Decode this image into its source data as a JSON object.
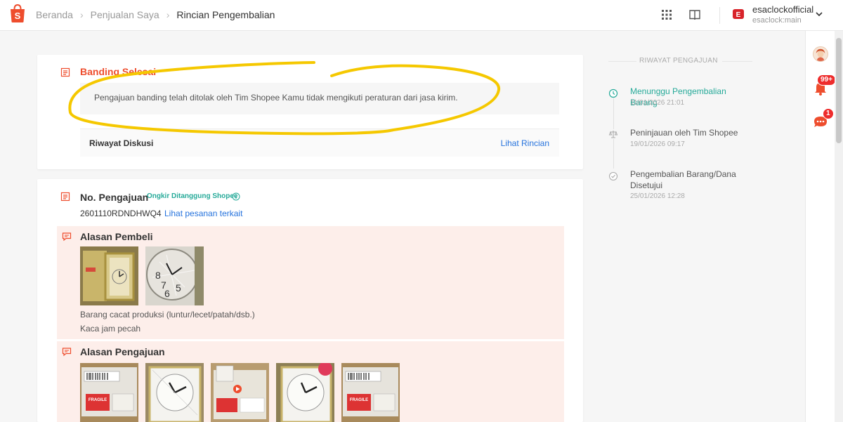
{
  "breadcrumb": {
    "items": [
      "Beranda",
      "Penjualan Saya"
    ],
    "current": "Rincian Pengembalian"
  },
  "account": {
    "shop_name": "esaclockofficial",
    "sub_account": "esaclock:main"
  },
  "rail": {
    "notif_badge": "99+",
    "chat_badge": "1"
  },
  "banding": {
    "title": "Banding Selesai",
    "message": "Pengajuan banding telah ditolak oleh Tim Shopee Kamu tidak mengikuti peraturan dari jasa kirim.",
    "diskusi_label": "Riwayat Diskusi",
    "diskusi_link": "Lihat Rincian"
  },
  "pengajuan": {
    "title": "No. Pengajuan",
    "tag": "Ongkir Ditanggung Shopee",
    "number": "2601110RDNDHWQ4",
    "link": "Lihat pesanan terkait"
  },
  "alasan_pembeli": {
    "title": "Alasan Pembeli",
    "reason": "Barang cacat produksi (luntur/lecet/patah/dsb.)",
    "note": "Kaca jam pecah"
  },
  "alasan_pengajuan": {
    "title": "Alasan Pengajuan",
    "badge_text": "FRAGILE"
  },
  "timeline": {
    "header": "RIWAYAT PENGAJUAN",
    "steps": [
      {
        "title": "Menunggu Pengembalian Barang",
        "time": "11/01/2026 21:01"
      },
      {
        "title": "Peninjauan oleh Tim Shopee",
        "time": "19/01/2026 09:17"
      },
      {
        "title_line1": "Pengembalian Barang/Dana",
        "title_line2": "Disetujui",
        "time": "25/01/2026 12:28"
      }
    ]
  },
  "colors": {
    "brand": "#ee4d2d",
    "link": "#2673dd",
    "success": "#26aa99",
    "highlight": "#f5c800"
  }
}
